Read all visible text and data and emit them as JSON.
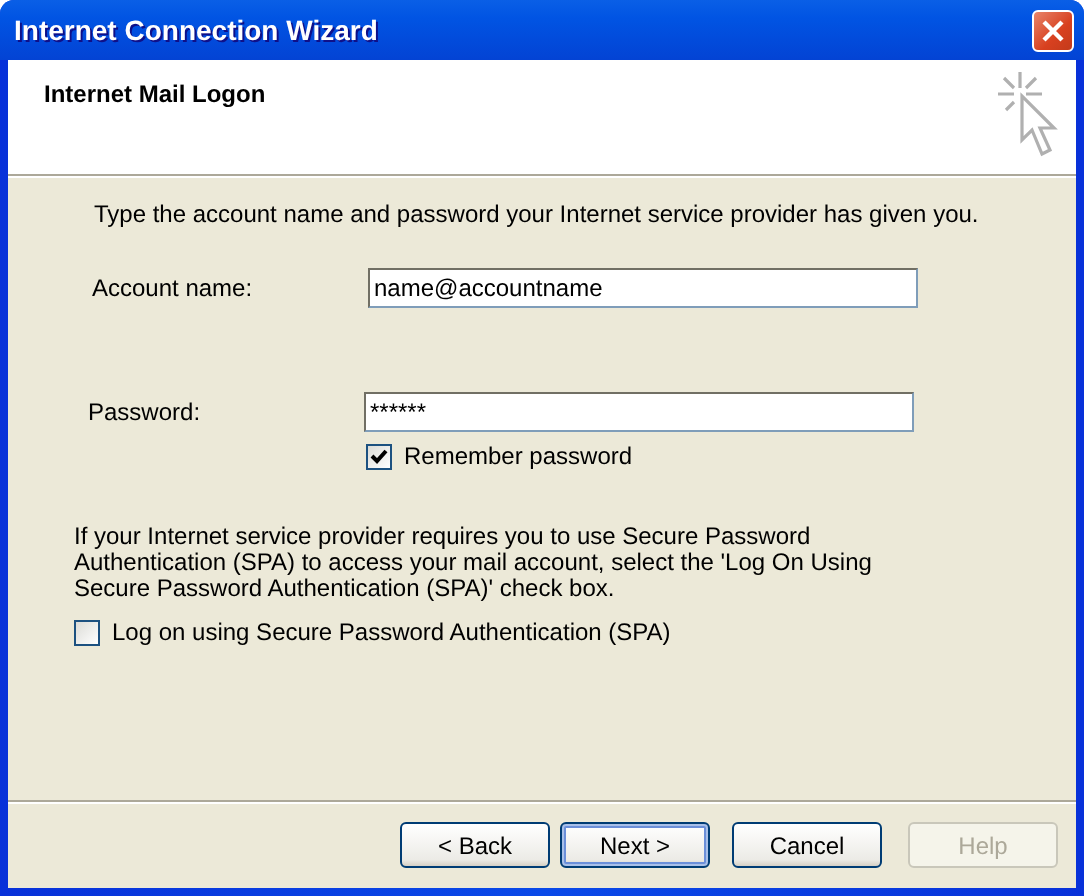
{
  "window": {
    "title": "Internet Connection Wizard"
  },
  "header": {
    "title": "Internet Mail Logon"
  },
  "intro": "Type the account name and password your Internet service provider has given you.",
  "fields": [
    {
      "label": "Account name:",
      "value": "name@accountname"
    },
    {
      "label": "Password:",
      "value": "******"
    }
  ],
  "remember_password": {
    "label": "Remember password",
    "checked": true
  },
  "spa_note": "If your Internet service provider requires you to use Secure Password Authentication (SPA) to access your mail account, select the 'Log On Using Secure Password Authentication (SPA)' check box.",
  "spa_checkbox": {
    "label": "Log on using Secure Password Authentication (SPA)",
    "checked": false
  },
  "buttons": [
    {
      "label": "< Back",
      "kind": "normal",
      "disabled": false
    },
    {
      "label": "Next >",
      "kind": "default",
      "disabled": false
    },
    {
      "label": "Cancel",
      "kind": "normal",
      "disabled": false
    },
    {
      "label": "Help",
      "kind": "normal",
      "disabled": true
    }
  ]
}
